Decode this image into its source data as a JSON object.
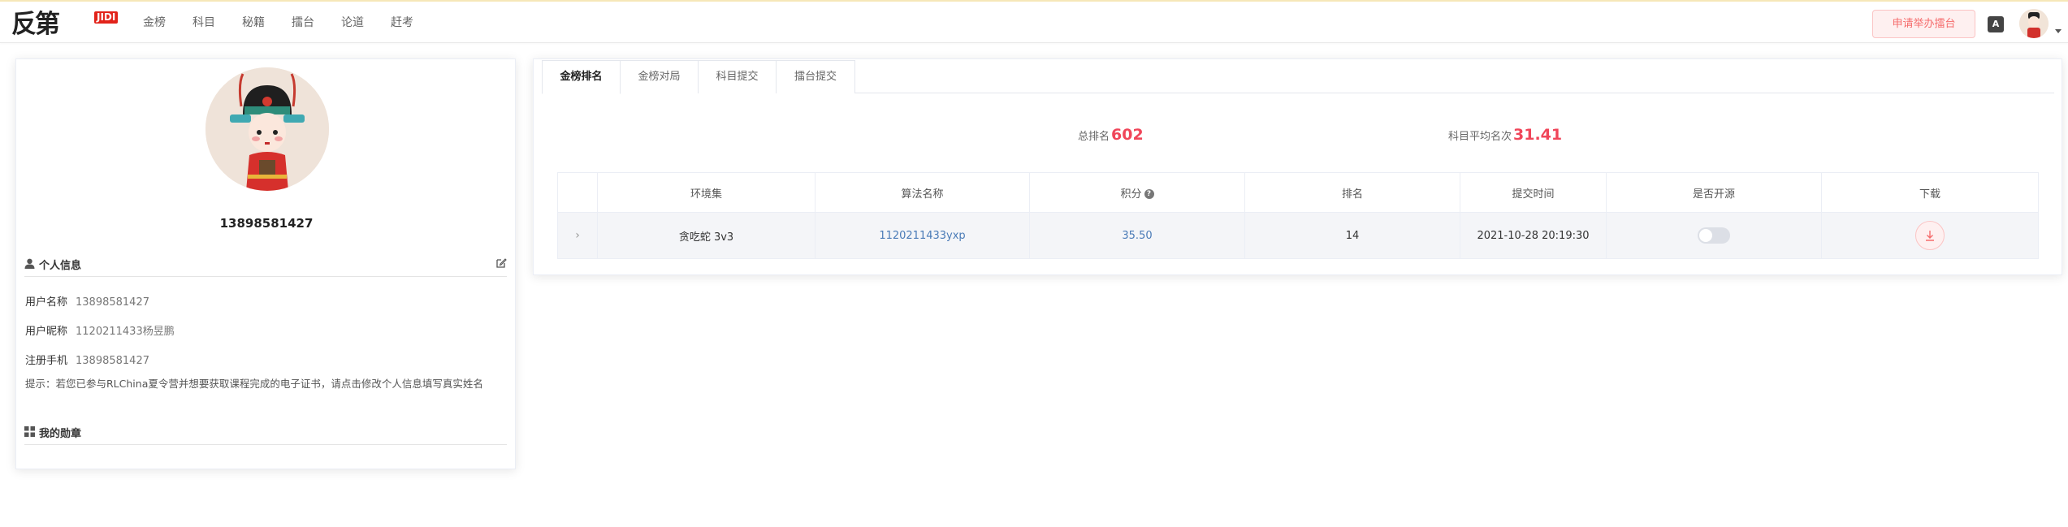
{
  "logo": {
    "text": "反第",
    "badge": "JIDI"
  },
  "nav": [
    "金榜",
    "科目",
    "秘籍",
    "擂台",
    "论道",
    "赶考"
  ],
  "header": {
    "apply_button": "申请举办擂台",
    "lang_icon": "A",
    "avatar_icon": "avatar-icon"
  },
  "profile": {
    "username": "13898581427",
    "section_personal": "个人信息",
    "fields": [
      {
        "label": "用户名称",
        "value": "13898581427"
      },
      {
        "label": "用户昵称",
        "value": "1120211433杨昱鹏"
      },
      {
        "label": "注册手机",
        "value": "13898581427"
      }
    ],
    "tip": "提示：若您已参与RLChina夏令营并想要获取课程完成的电子证书，请点击修改个人信息填写真实姓名",
    "section_medals": "我的勋章"
  },
  "tabs": [
    "金榜排名",
    "金榜对局",
    "科目提交",
    "擂台提交"
  ],
  "active_tab": 0,
  "stats": {
    "total_rank_label": "总排名",
    "total_rank_value": "602",
    "avg_rank_label": "科目平均名次",
    "avg_rank_value": "31.41"
  },
  "table": {
    "headers": [
      "",
      "环境集",
      "算法名称",
      "积分",
      "排名",
      "提交时间",
      "是否开源",
      "下载"
    ],
    "rows": [
      {
        "expand": "›",
        "env": "贪吃蛇 3v3",
        "algo": "1120211433yxp",
        "score": "35.50",
        "rank": "14",
        "time": "2021-10-28 20:19:30",
        "open_source": false
      }
    ]
  },
  "colors": {
    "accent_red": "#f0465a",
    "link_blue": "#4a7bb7",
    "apply_bg": "#fef0f0"
  }
}
